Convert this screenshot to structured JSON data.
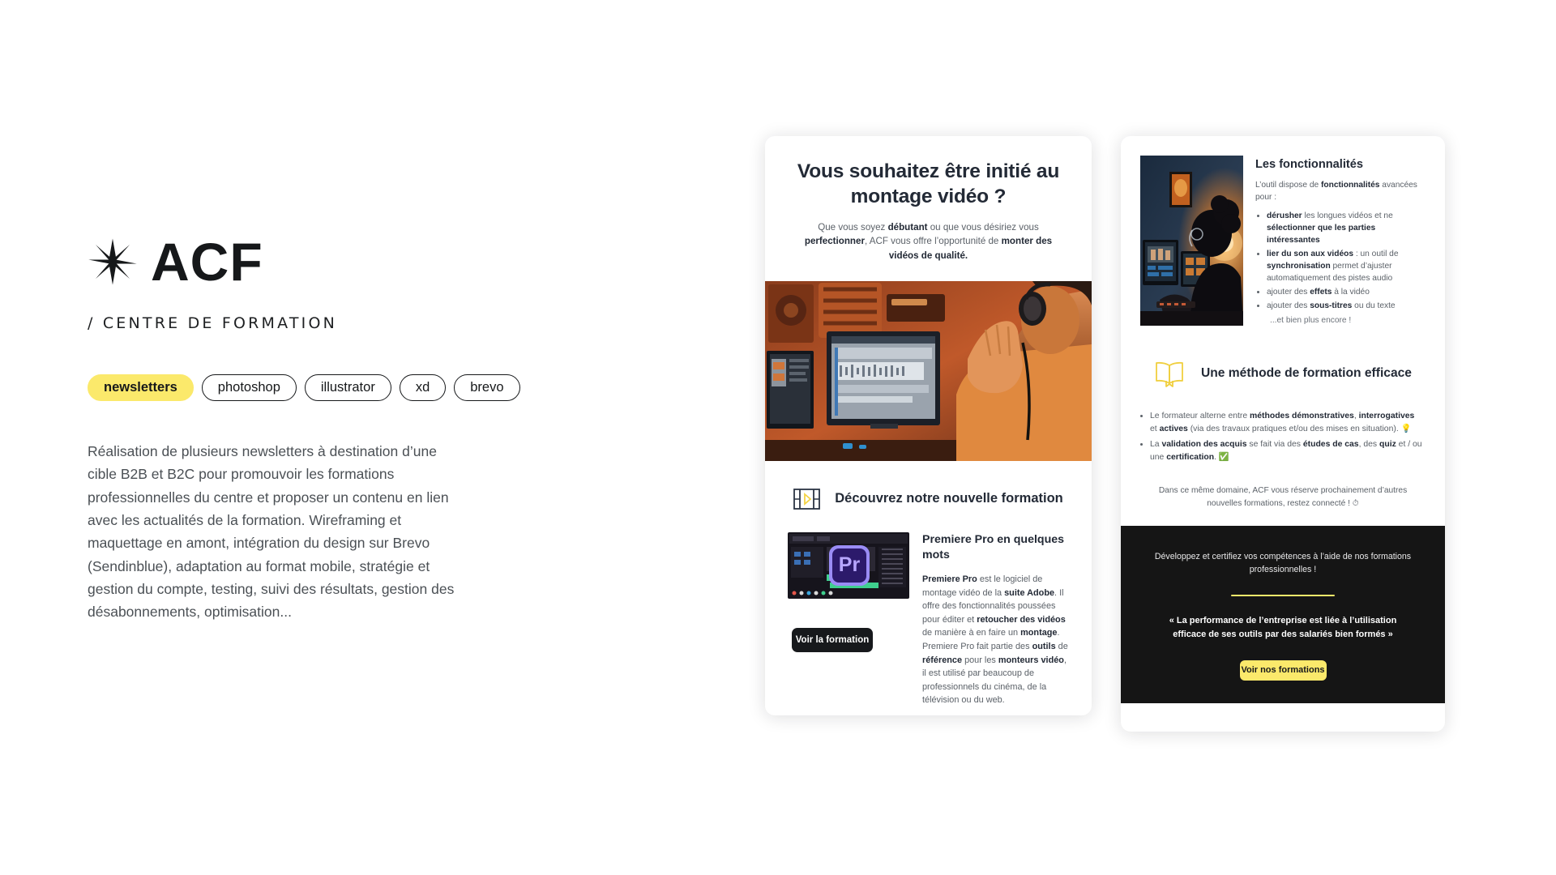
{
  "project": {
    "logo_icon": "asterisk-star-icon",
    "brand_name": "ACF",
    "subtitle": "/ CENTRE DE FORMATION",
    "tags": [
      {
        "label": "newsletters",
        "active": true
      },
      {
        "label": "photoshop",
        "active": false
      },
      {
        "label": "illustrator",
        "active": false
      },
      {
        "label": "xd",
        "active": false
      },
      {
        "label": "brevo",
        "active": false
      }
    ],
    "description": "Réalisation de plusieurs newsletters à destination d’une cible B2B et B2C pour promouvoir les formations professionnelles du centre et proposer un contenu en lien avec les actualités de la formation. Wireframing et maquettage en amont, intégration du design sur Brevo (Sendinblue), adaptation au format mobile, stratégie et gestion du compte, testing, suivi des résultats, gestion des désabonnements, optimisation..."
  },
  "newsletter_a": {
    "title": "Vous souhaitez être initié au montage vidéo ?",
    "subtitle_parts": [
      {
        "text": "Que vous soyez ",
        "bold": false
      },
      {
        "text": "débutant",
        "bold": true
      },
      {
        "text": " ou que vous désiriez vous ",
        "bold": false
      },
      {
        "text": "perfectionner",
        "bold": true
      },
      {
        "text": ", ACF vous offre l’opportunité de ",
        "bold": false
      },
      {
        "text": "monter des vidéos de qualité.",
        "bold": true
      }
    ],
    "hero_alt": "video-editor-with-headphones-at-workstation",
    "section_icon": "film-strip-play-icon",
    "section_title": "Découvrez notre nouvelle formation",
    "thumb_alt": "premiere-pro-timeline-screenshot",
    "thumb_logo": "Pr",
    "cta_label": "Voir la formation",
    "promo_title": "Premiere Pro en quelques mots",
    "promo_body_parts": [
      {
        "text": "Premiere Pro",
        "bold": true
      },
      {
        "text": " est le logiciel de montage vidéo de la ",
        "bold": false
      },
      {
        "text": "suite Adobe",
        "bold": true
      },
      {
        "text": ". Il offre des fonctionnalités poussées pour éditer et ",
        "bold": false
      },
      {
        "text": "retoucher des vidéos",
        "bold": true
      },
      {
        "text": " de manière à en faire un ",
        "bold": false
      },
      {
        "text": "montage",
        "bold": true
      },
      {
        "text": ". Premiere Pro fait partie des ",
        "bold": false
      },
      {
        "text": "outils",
        "bold": true
      },
      {
        "text": " de ",
        "bold": false
      },
      {
        "text": "référence",
        "bold": true
      },
      {
        "text": " pour les ",
        "bold": false
      },
      {
        "text": "monteurs vidéo",
        "bold": true
      },
      {
        "text": ", il est utilisé par beaucoup de professionnels du cinéma, de la télévision ou du web.",
        "bold": false
      }
    ]
  },
  "newsletter_b": {
    "feature_img_alt": "silhouette-person-editing-at-dual-monitors",
    "features_title": "Les fonctionnalités",
    "features_intro_parts": [
      {
        "text": "L’outil dispose de ",
        "bold": false
      },
      {
        "text": "fonctionnalités",
        "bold": true
      },
      {
        "text": " avancées pour :",
        "bold": false
      }
    ],
    "features_list": [
      [
        {
          "text": "dérusher",
          "bold": true
        },
        {
          "text": " les longues vidéos et ne ",
          "bold": false
        },
        {
          "text": "sélectionner que les parties intéressantes",
          "bold": true
        }
      ],
      [
        {
          "text": "lier du son aux vidéos",
          "bold": true
        },
        {
          "text": " : un outil de ",
          "bold": false
        },
        {
          "text": "synchronisation",
          "bold": true
        },
        {
          "text": " permet d’ajuster automatiquement des pistes audio",
          "bold": false
        }
      ],
      [
        {
          "text": "ajouter des ",
          "bold": false
        },
        {
          "text": "effets",
          "bold": true
        },
        {
          "text": " à la vidéo",
          "bold": false
        }
      ],
      [
        {
          "text": "ajouter des ",
          "bold": false
        },
        {
          "text": "sous-titres",
          "bold": true
        },
        {
          "text": " ou du texte",
          "bold": false
        }
      ]
    ],
    "features_more": "...et bien plus encore !",
    "method_icon": "open-book-icon",
    "method_title": "Une méthode de formation efficace",
    "method_list": [
      [
        {
          "text": "Le formateur alterne entre ",
          "bold": false
        },
        {
          "text": "méthodes démonstratives",
          "bold": true
        },
        {
          "text": ", ",
          "bold": false
        },
        {
          "text": "interrogatives",
          "bold": true
        },
        {
          "text": " et ",
          "bold": false
        },
        {
          "text": "actives",
          "bold": true
        },
        {
          "text": " (via des travaux pratiques et/ou des mises en situation). 💡",
          "bold": false
        }
      ],
      [
        {
          "text": "La ",
          "bold": false
        },
        {
          "text": "validation des acquis",
          "bold": true
        },
        {
          "text": " se fait via des ",
          "bold": false
        },
        {
          "text": "études de cas",
          "bold": true
        },
        {
          "text": ", des ",
          "bold": false
        },
        {
          "text": "quiz",
          "bold": true
        },
        {
          "text": " et / ou une ",
          "bold": false
        },
        {
          "text": "certification",
          "bold": true
        },
        {
          "text": ". ✅",
          "bold": false
        }
      ]
    ],
    "outro": "Dans ce même domaine, ACF vous réserve prochainement d’autres nouvelles formations, restez connecté ! ⏱",
    "dark_lead": "Développez et certifiez vos compétences à l’aide de nos formations professionnelles !",
    "dark_quote": "« La performance de l’entreprise est liée à l’utilisation efficace de ses outils par des salariés bien formés »",
    "dark_cta_label": "Voir nos formations"
  },
  "colors": {
    "accent_yellow": "#fbe96b",
    "ink": "#16181a",
    "navy_text": "#232a36",
    "body_text": "#5b6168",
    "dark_block": "#151515"
  }
}
